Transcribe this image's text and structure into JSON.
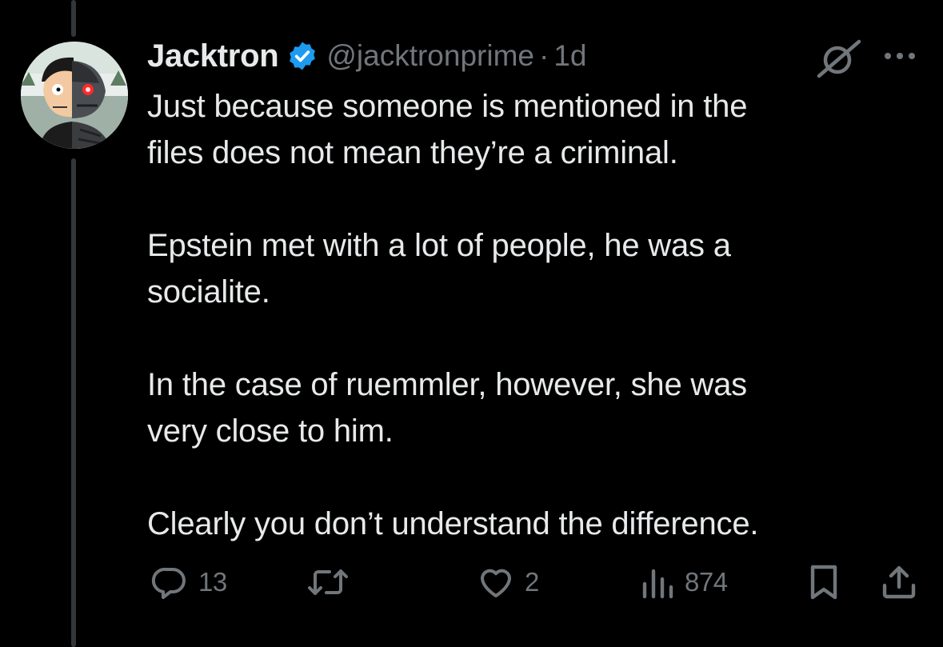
{
  "post": {
    "author": {
      "display_name": "Jacktron",
      "handle": "@jacktronprime",
      "verified": true,
      "avatar": "cartoon-avatar-half-human-half-robot"
    },
    "separator": "·",
    "timestamp": "1d",
    "paragraphs": [
      "Just because someone is mentioned in the\nfiles does not mean they’re a criminal.",
      "Epstein met with a lot of people, he was a\nsocialite.",
      "In the case of ruemmler, however, she was\nvery close to him.",
      "Clearly you don’t understand the difference."
    ],
    "stats": {
      "replies": "13",
      "likes": "2",
      "views": "874"
    }
  },
  "icons": {
    "verified": "verified-badge-icon",
    "grok": "grok-icon",
    "more": "more-icon",
    "reply": "reply-icon",
    "retweet": "retweet-icon",
    "like": "heart-icon",
    "views": "views-icon",
    "bookmark": "bookmark-icon",
    "share": "share-icon"
  },
  "colors": {
    "background": "#000000",
    "text": "#e7e9ea",
    "secondary": "#71767b",
    "verified": "#1d9bf0",
    "thread_line": "#333639"
  }
}
